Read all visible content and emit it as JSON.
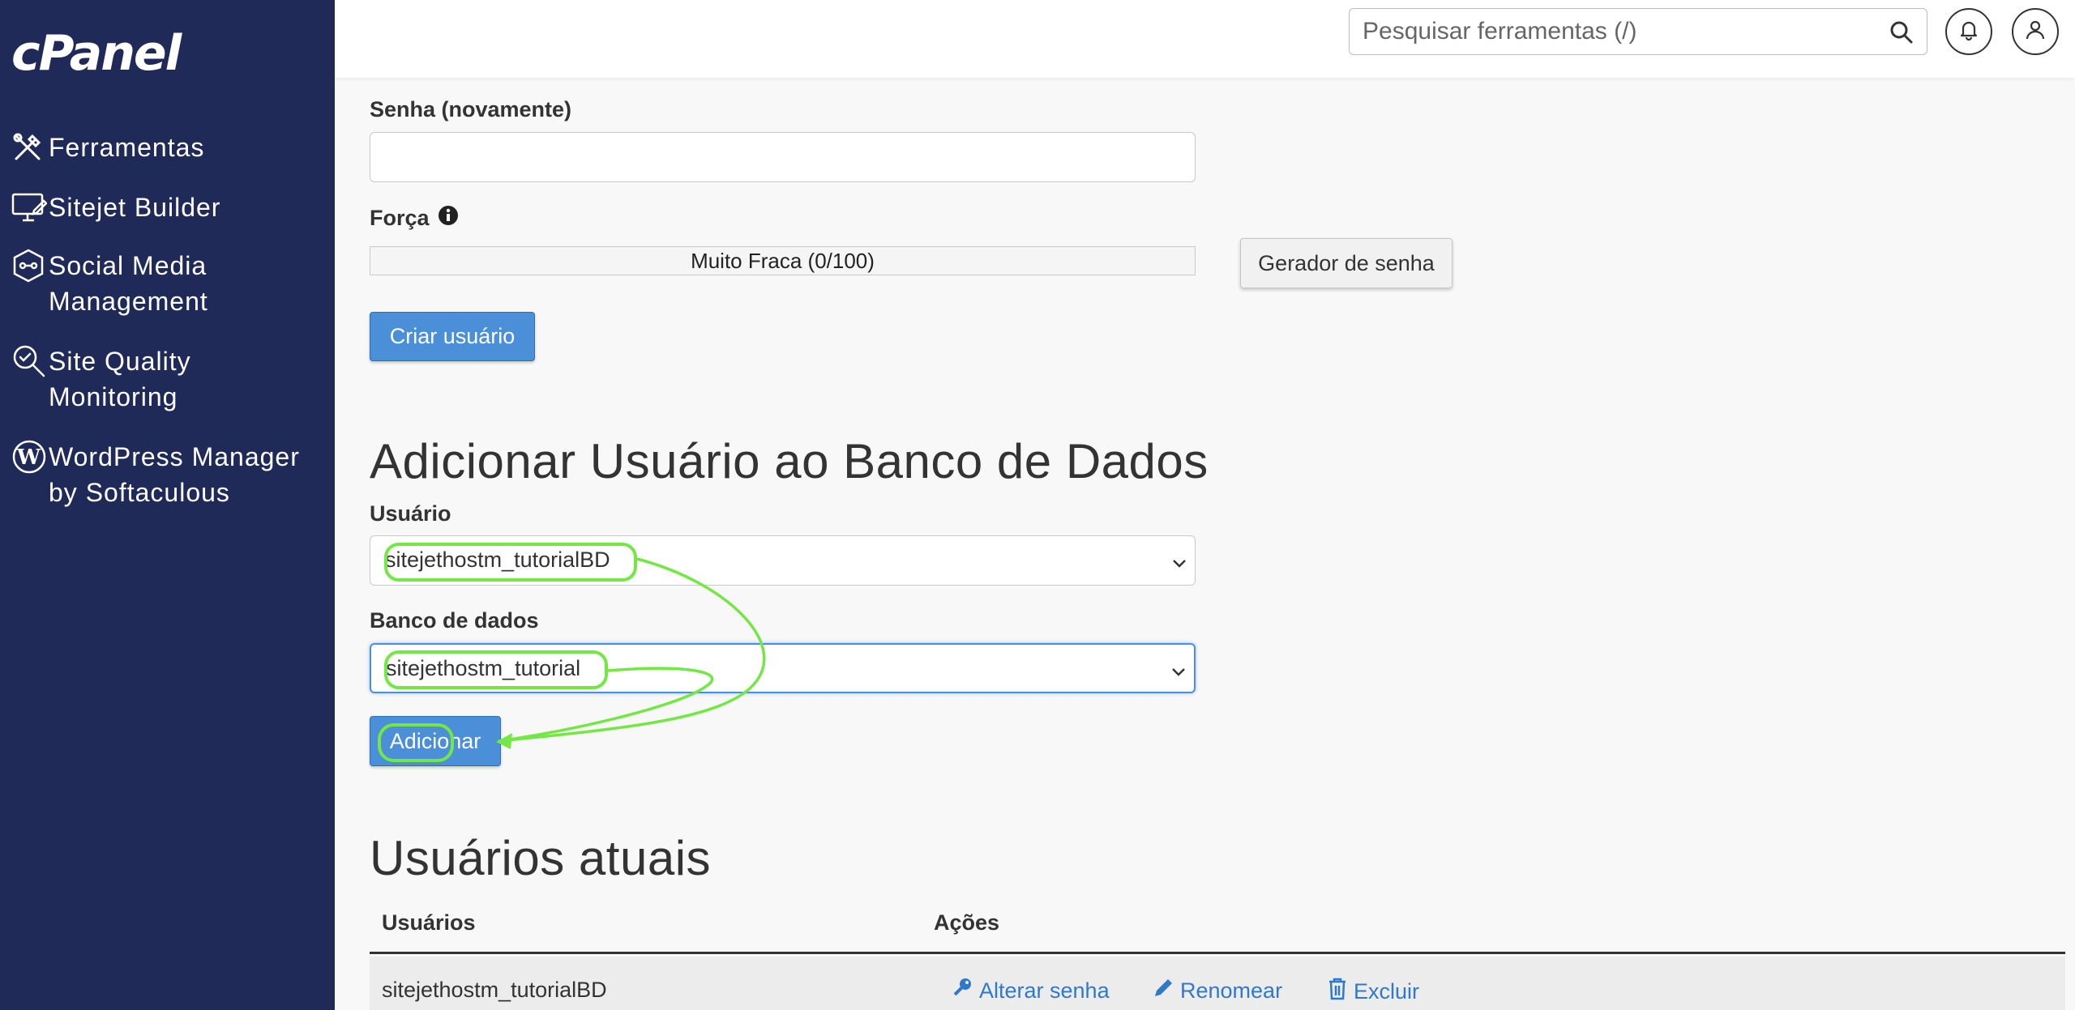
{
  "app": {
    "logo": "cPanel"
  },
  "sidebar": {
    "items": [
      {
        "label": "Ferramentas",
        "icon": "tools-icon"
      },
      {
        "label": "Sitejet Builder",
        "icon": "monitor-edit-icon"
      },
      {
        "label": "Social Media Management",
        "icon": "social-hexagon-icon"
      },
      {
        "label": "Site Quality Monitoring",
        "icon": "magnifier-check-icon"
      },
      {
        "label": "WordPress Manager by Softaculous",
        "icon": "wordpress-icon"
      }
    ]
  },
  "header": {
    "search_placeholder": "Pesquisar ferramentas (/)"
  },
  "form": {
    "password_again_label": "Senha (novamente)",
    "strength_label": "Força",
    "strength_text": "Muito Fraca (0/100)",
    "strength_value": 0,
    "generator_label": "Gerador de senha",
    "create_user_label": "Criar usuário"
  },
  "add_user_section": {
    "title": "Adicionar Usuário ao Banco de Dados",
    "user_label": "Usuário",
    "user_selected": "sitejethostm_tutorialBD",
    "db_label": "Banco de dados",
    "db_selected": "sitejethostm_tutorial",
    "add_label": "Adicionar"
  },
  "current_users": {
    "title": "Usuários atuais",
    "columns": [
      "Usuários",
      "Ações"
    ],
    "rows": [
      {
        "user": "sitejethostm_tutorialBD",
        "actions": [
          "Alterar senha",
          "Renomear",
          "Excluir"
        ]
      }
    ]
  },
  "colors": {
    "sidebar_bg": "#1f2a58",
    "primary": "#4a8fd8",
    "link": "#2f7ac8",
    "annotation": "#73e845"
  }
}
